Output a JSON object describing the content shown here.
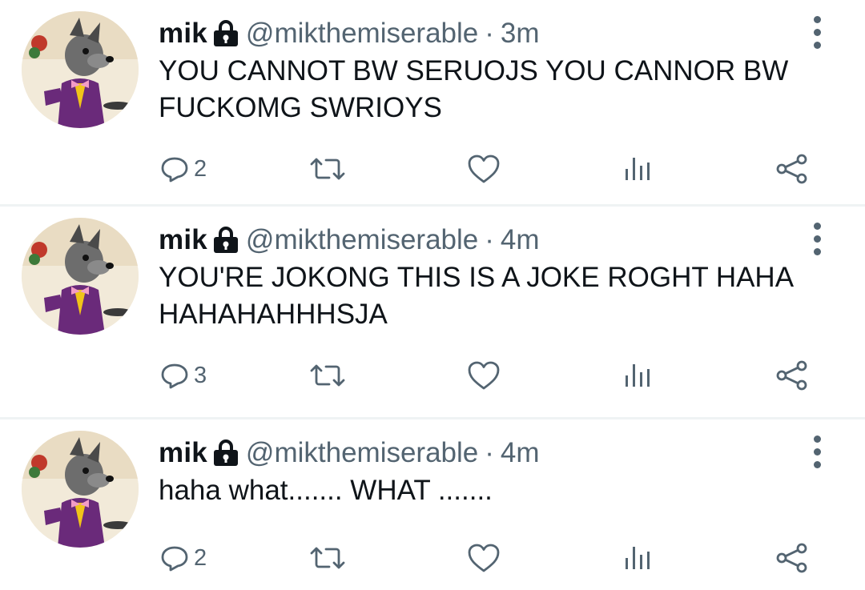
{
  "tweets": [
    {
      "name": "mik",
      "handle": "@mikthemiserable",
      "separator": "·",
      "time": "3m",
      "text": "YOU CANNOT BW SERUOJS YOU CANNOR BW FUCKOMG SWRIOYS",
      "reply_count": "2"
    },
    {
      "name": "mik",
      "handle": "@mikthemiserable",
      "separator": "·",
      "time": "4m",
      "text": "YOU'RE JOKONG THIS IS A JOKE ROGHT HAHA HAHAHAHHHSJA",
      "reply_count": "3"
    },
    {
      "name": "mik",
      "handle": "@mikthemiserable",
      "separator": "·",
      "time": "4m",
      "text": "haha what....... WHAT .......",
      "reply_count": "2"
    }
  ],
  "icons": {
    "verified_lock": "lock-icon",
    "more": "more-vertical-icon",
    "reply": "reply-icon",
    "retweet": "retweet-icon",
    "like": "heart-icon",
    "views": "views-icon",
    "share": "share-icon"
  },
  "colors": {
    "text": "#0f1419",
    "secondary": "#536471",
    "divider": "#eff3f4"
  }
}
